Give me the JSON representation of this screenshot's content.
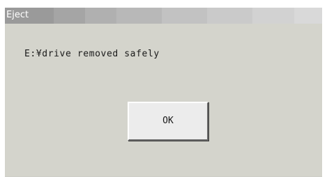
{
  "window": {
    "title": "Eject"
  },
  "message": {
    "text": "E:¥drive removed safely"
  },
  "buttons": {
    "ok_label": "OK"
  }
}
